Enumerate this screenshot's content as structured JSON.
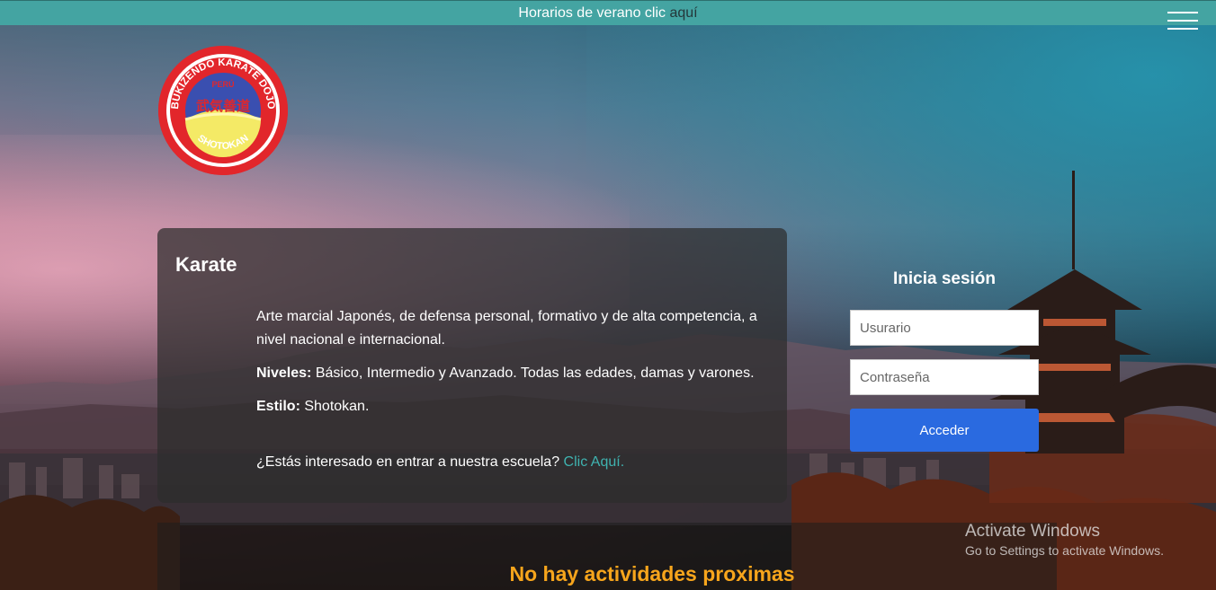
{
  "banner": {
    "text": "Horarios de verano clic",
    "link": "aquí"
  },
  "logo": {
    "top_text": "BUKIZENDO KARATE DOJO",
    "country": "PERÚ",
    "kanji": "武気善道",
    "bottom_text": "SHOTOKAN"
  },
  "card": {
    "title": "Karate",
    "description": "Arte marcial Japonés, de defensa personal, formativo y de alta competencia, a nivel nacional e internacional.",
    "levels_label": "Niveles:",
    "levels_value": "Básico, Intermedio y Avanzado. Todas las edades, damas y varones.",
    "style_label": "Estilo:",
    "style_value": "Shotokan.",
    "cta_text": "¿Estás interesado en entrar a nuestra escuela?",
    "cta_link": "Clic Aquí."
  },
  "login": {
    "title": "Inicia sesión",
    "user_placeholder": "Usurario",
    "password_placeholder": "Contraseña",
    "submit_label": "Acceder"
  },
  "activities": {
    "title": "No hay actividades proximas"
  },
  "watermark": {
    "line1": "Activate Windows",
    "line2": "Go to Settings to activate Windows."
  },
  "colors": {
    "banner_bg": "#44a4a2",
    "button_bg": "#2a6ae0",
    "link": "#3fb3b0",
    "activities_title": "#f7a51c",
    "logo_red": "#e2262b"
  }
}
